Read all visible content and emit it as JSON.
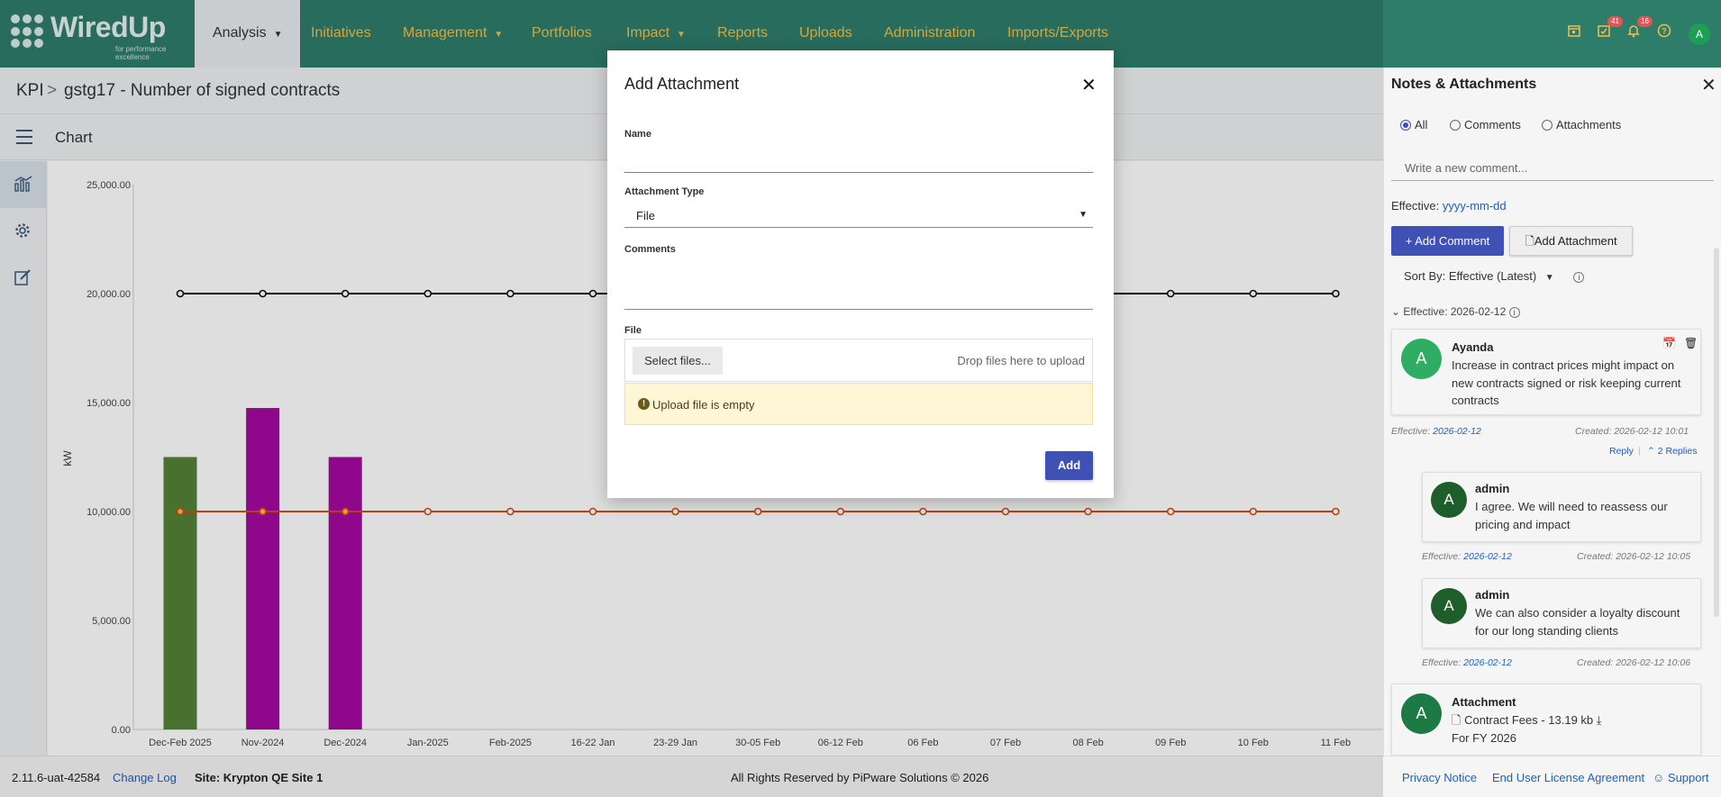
{
  "nav": {
    "logo": {
      "word": "WiredUp",
      "tagline": "for performance excellence"
    },
    "tabs": [
      {
        "label": "Analysis",
        "has_menu": true,
        "active": true
      },
      {
        "label": "Initiatives"
      },
      {
        "label": "Management",
        "has_menu": true
      },
      {
        "label": "Portfolios"
      },
      {
        "label": "Impact",
        "has_menu": true
      },
      {
        "label": "Reports"
      },
      {
        "label": "Uploads"
      },
      {
        "label": "Administration"
      },
      {
        "label": "Imports/Exports"
      }
    ],
    "icons": {
      "calendar": "calendar-icon",
      "tasks": "tasks-icon",
      "tasks_badge": "41",
      "bell": "bell-icon",
      "bell_badge": "16",
      "help": "help-icon"
    },
    "user_initial": "A",
    "accent": "#f3c04a",
    "bar_color": "#2e7d6b"
  },
  "breadcrumb": {
    "root": "KPI",
    "separator": ">",
    "current": "gstg17 - Number of signed contracts"
  },
  "chart_header": {
    "title": "Chart"
  },
  "chart_data": {
    "type": "bar",
    "ylabel": "kW",
    "ylim": [
      0,
      25000
    ],
    "yticks": [
      "0.00",
      "5,000.00",
      "10,000.00",
      "15,000.00",
      "20,000.00",
      "25,000.00"
    ],
    "categories": [
      "Dec-Feb 2025",
      "Nov-2024",
      "Dec-2024",
      "Jan-2025",
      "Feb-2025",
      "16-22 Jan",
      "23-29 Jan",
      "30-05 Feb",
      "06-12 Feb",
      "06 Feb",
      "07 Feb",
      "08 Feb",
      "09 Feb",
      "10 Feb",
      "11 Feb"
    ],
    "bars": [
      {
        "category": "Dec-Feb 2025",
        "value": 12500,
        "color": "#538135"
      },
      {
        "category": "Nov-2024",
        "value": 14750,
        "color": "#a50aa0"
      },
      {
        "category": "Dec-2024",
        "value": 12500,
        "color": "#a50aa0"
      }
    ],
    "series": [
      {
        "type": "line",
        "color": "#111111",
        "values": [
          20000,
          20000,
          20000,
          20000,
          20000,
          20000,
          20000,
          20000,
          20000,
          20000,
          20000,
          20000,
          20000,
          20000,
          20000
        ]
      },
      {
        "type": "line",
        "color": "#d84a12",
        "values": [
          10000,
          10000,
          10000,
          10000,
          10000,
          10000,
          10000,
          10000,
          10000,
          10000,
          10000,
          10000,
          10000,
          10000,
          10000
        ]
      }
    ],
    "grid": false
  },
  "footer": {
    "version": "2.11.6-uat-42584",
    "changelog": "Change Log",
    "site": "Site: Krypton QE Site 1",
    "rights": "All Rights Reserved by PiPware Solutions © 2026",
    "privacy": "Privacy Notice",
    "eula": "End User License Agreement",
    "support": "Support"
  },
  "modal": {
    "title": "Add Attachment",
    "name_label": "Name",
    "name_value": "",
    "type_label": "Attachment Type",
    "type_value": "File",
    "comments_label": "Comments",
    "comments_value": "",
    "file_label": "File",
    "select_files": "Select files...",
    "drop_hint": "Drop files here to upload",
    "warning": "Upload file is empty",
    "add": "Add"
  },
  "notes": {
    "title": "Notes & Attachments",
    "filters": [
      {
        "label": "All",
        "checked": true
      },
      {
        "label": "Comments"
      },
      {
        "label": "Attachments"
      }
    ],
    "new_comment_placeholder": "Write a new comment...",
    "effective_label": "Effective:",
    "effective_placeholder": "yyyy-mm-dd",
    "add_comment": "+ Add Comment",
    "add_attachment": "Add Attachment",
    "sort_by": "Sort By: Effective (Latest)",
    "group_label": "Effective: 2026-02-12",
    "items": [
      {
        "author": "Ayanda",
        "initial": "A",
        "text": "Increase in contract prices might impact on new contracts signed or risk keeping current contracts",
        "effective_label": "Effective:",
        "effective": "2026-02-12",
        "created": "Created: 2026-02-12 10:01",
        "reply": "Reply",
        "replies": "2 Replies"
      },
      {
        "author": "admin",
        "initial": "A",
        "text": "I agree. We will need to reassess our pricing and impact",
        "effective_label": "Effective:",
        "effective": "2026-02-12",
        "created": "Created: 2026-02-12 10:05"
      },
      {
        "author": "admin",
        "initial": "A",
        "text": "We can also consider a loyalty discount for our long standing clients",
        "effective_label": "Effective:",
        "effective": "2026-02-12",
        "created": "Created: 2026-02-12 10:06"
      },
      {
        "author": "Attachment",
        "initial": "A",
        "file": "Contract Fees - 13.19 kb",
        "text": "For FY 2026"
      }
    ]
  }
}
